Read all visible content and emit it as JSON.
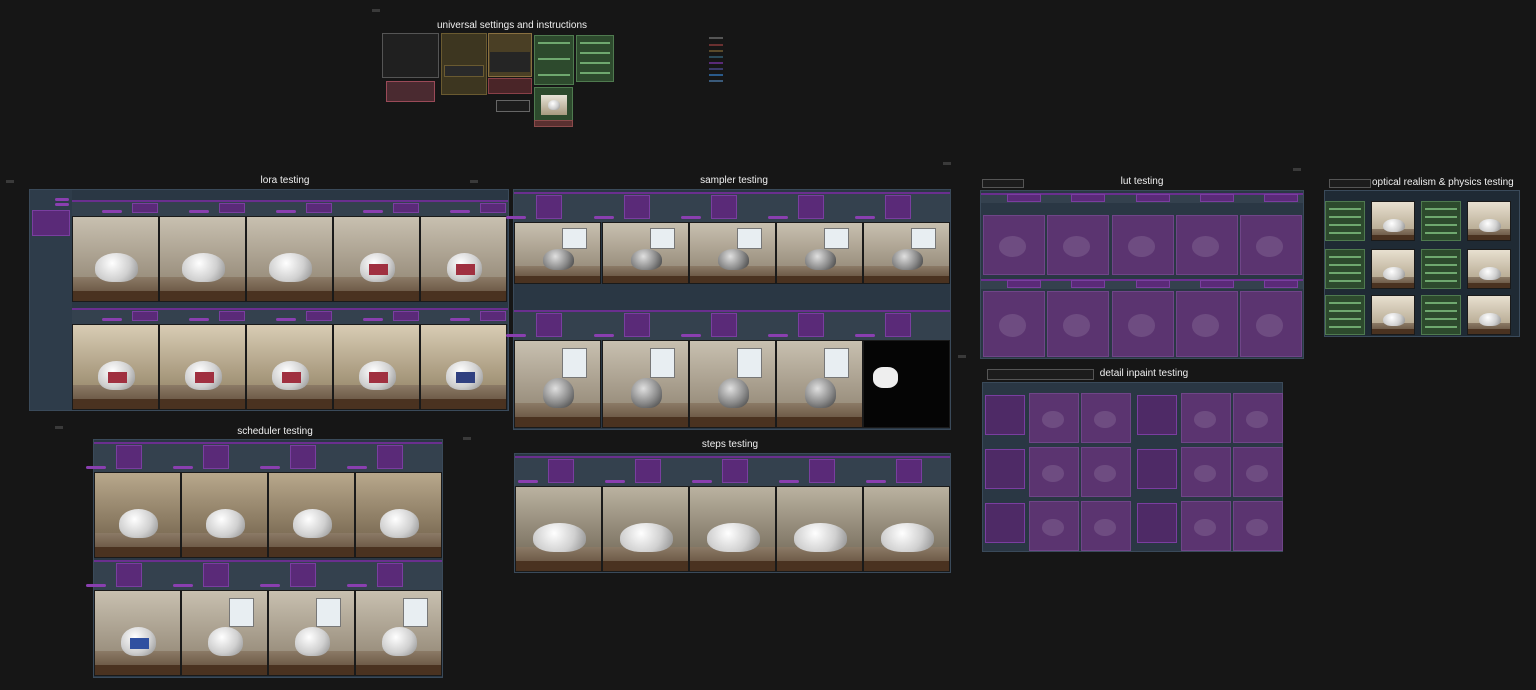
{
  "groups": {
    "universal": "universal settings and instructions",
    "lora": "lora testing",
    "sampler": "sampler testing",
    "lut": "lut testing",
    "optical": "optical realism & physics testing",
    "scheduler": "scheduler testing",
    "steps": "steps testing",
    "detail": "detail inpaint testing"
  },
  "colors": {
    "canvas_bg": "#161616",
    "group_bg": "#2a3744",
    "node_purple": "#5a2a78",
    "node_green": "#2d4a2d"
  }
}
